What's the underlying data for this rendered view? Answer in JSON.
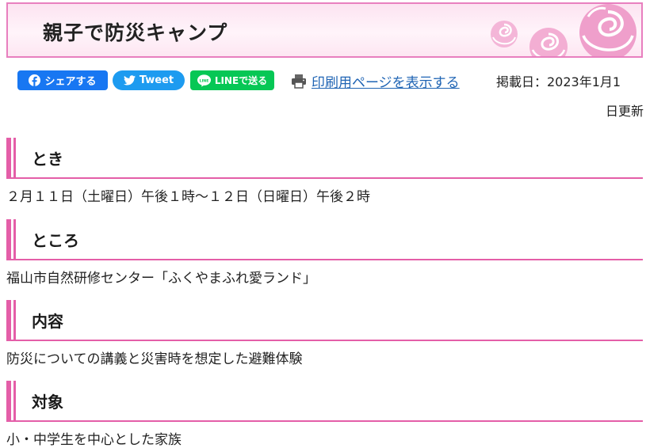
{
  "title": "親子で防災キャンプ",
  "share": {
    "facebook": "シェアする",
    "twitter": "Tweet",
    "line": "LINEで送る"
  },
  "print_link": "印刷用ページを表示する",
  "posted_line1": "掲載日：2023年1月1",
  "posted_line2": "日更新",
  "sections": [
    {
      "heading": "とき",
      "body": "２月１１日（土曜日）午後１時～１２日（日曜日）午後２時"
    },
    {
      "heading": "ところ",
      "body": "福山市自然研修センター「ふくやまふれ愛ランド」"
    },
    {
      "heading": "内容",
      "body": "防災についての講義と災害時を想定した避難体験"
    },
    {
      "heading": "対象",
      "body": "小・中学生を中心とした家族"
    }
  ],
  "colors": {
    "accent": "#e45ea8",
    "banner_border": "#e87fbf",
    "facebook": "#1877f2",
    "twitter": "#1d9bf0",
    "line": "#06c755",
    "link": "#1f64b4"
  }
}
